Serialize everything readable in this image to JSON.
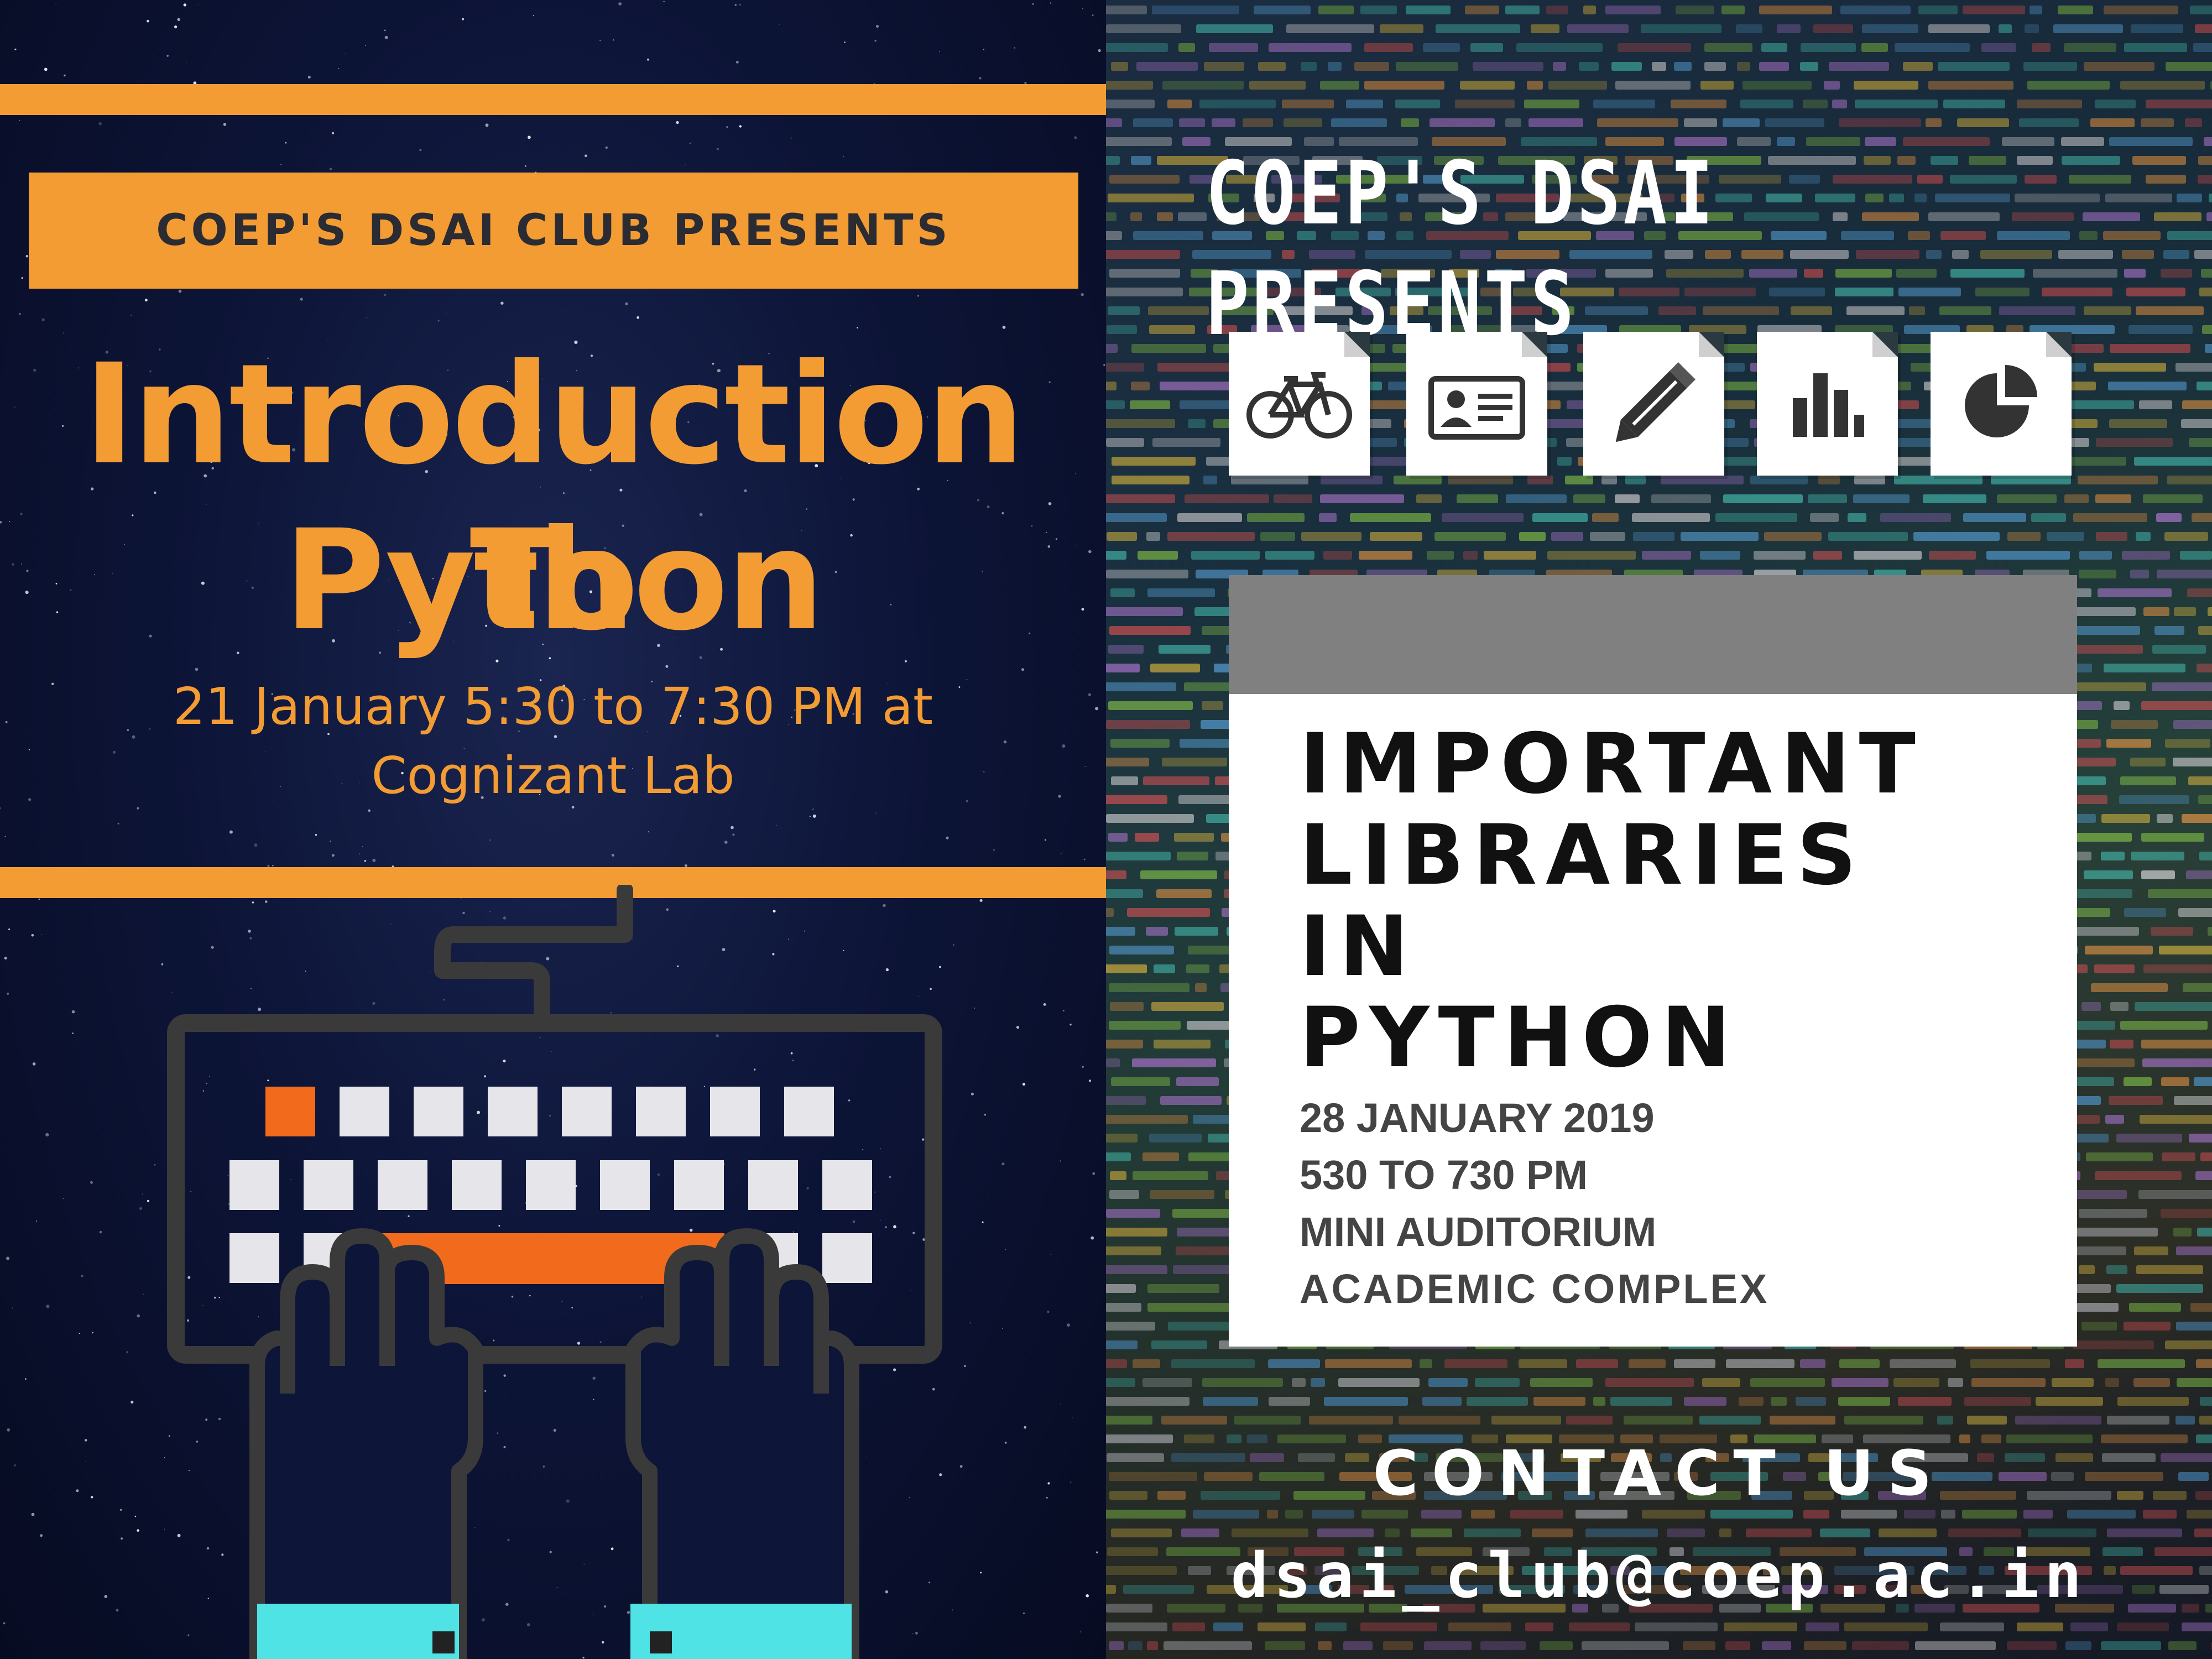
{
  "left_poster": {
    "presents": "COEP'S DSAI CLUB PRESENTS",
    "title_line1": "Introduction To",
    "title_line2": "Python",
    "when_line1": "21 January 5:30 to 7:30 PM at",
    "when_line2": "Cognizant Lab",
    "colors": {
      "accent": "#f39c33",
      "background": "#0d1538",
      "key_highlight": "#f26b1d",
      "keys": "#e6e6ea",
      "cuffs": "#4fe3e6",
      "outline": "#3a3a3a"
    }
  },
  "right_poster": {
    "presents": "COEP'S DSAI PRESENTS",
    "icons": [
      "bicycle-icon",
      "id-card-icon",
      "pencil-icon",
      "bar-chart-icon",
      "pie-chart-icon"
    ],
    "title_lines": [
      "IMPORTANT",
      "LIBRARIES",
      "IN",
      "PYTHON"
    ],
    "details": [
      "28 JANUARY 2019",
      "530 TO 730 PM",
      "MINI AUDITORIUM",
      "ACADEMIC COMPLEX"
    ],
    "contact_heading": "CONTACT US",
    "email": "dsai_club@coep.ac.in",
    "colors": {
      "card": "#ffffff",
      "card_header": "#808080",
      "title": "#111111",
      "details": "#444444",
      "text": "#ffffff"
    }
  }
}
